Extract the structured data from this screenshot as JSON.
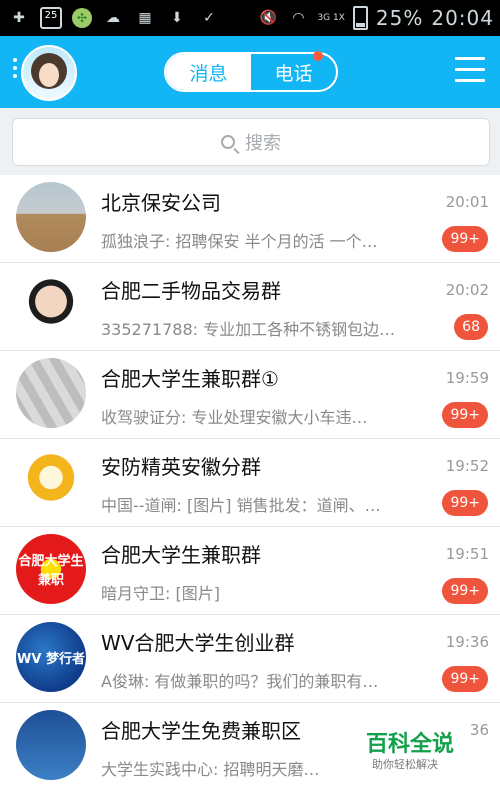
{
  "statusbar": {
    "icons": [
      "plus-icon",
      "number-25-icon",
      "game-icon",
      "weather-icon",
      "image-icon",
      "download-icon",
      "check-icon",
      "mute-icon",
      "wifi-icon",
      "signal-icon",
      "battery-icon"
    ],
    "box_number": "25",
    "network": "3G 1X",
    "battery": "25%",
    "time": "20:04"
  },
  "header": {
    "tabs": [
      "消息",
      "电话"
    ],
    "active_tab": "消息",
    "accent": "#12b6f5",
    "notification_color": "#ff5a3c"
  },
  "search": {
    "placeholder": "搜索"
  },
  "chats": [
    {
      "title": "北京保安公司",
      "subtitle": "孤独浪子: 招聘保安 半个月的活 一个…",
      "time": "20:01",
      "badge": "99+"
    },
    {
      "title": "合肥二手物品交易群",
      "subtitle": "335271788: 专业加工各种不锈钢包边…",
      "time": "20:02",
      "badge": "68"
    },
    {
      "title": "合肥大学生兼职群①",
      "subtitle": "收驾驶证分: 专业处理安徽大小车违…",
      "time": "19:59",
      "badge": "99+"
    },
    {
      "title": "安防精英安徽分群",
      "subtitle": "中国--道闸: [图片] 销售批发：道闸、…",
      "time": "19:52",
      "badge": "99+"
    },
    {
      "title": "合肥大学生兼职群",
      "subtitle": "暗月守卫: [图片]",
      "time": "19:51",
      "badge": "99+"
    },
    {
      "title": "WV合肥大学生创业群",
      "subtitle": "A俊琳: 有做兼职的吗？我们的兼职有…",
      "time": "19:36",
      "badge": "99+"
    },
    {
      "title": "合肥大学生免费兼职区",
      "subtitle": "大学生实践中心: 招聘明天磨…",
      "time": "36",
      "badge": ""
    }
  ],
  "avatar_texts": {
    "row5": "合肥大学生兼职",
    "row6": "WV 梦行者"
  },
  "watermark": {
    "title": "百科全说",
    "subtitle": "助你轻松解决"
  }
}
